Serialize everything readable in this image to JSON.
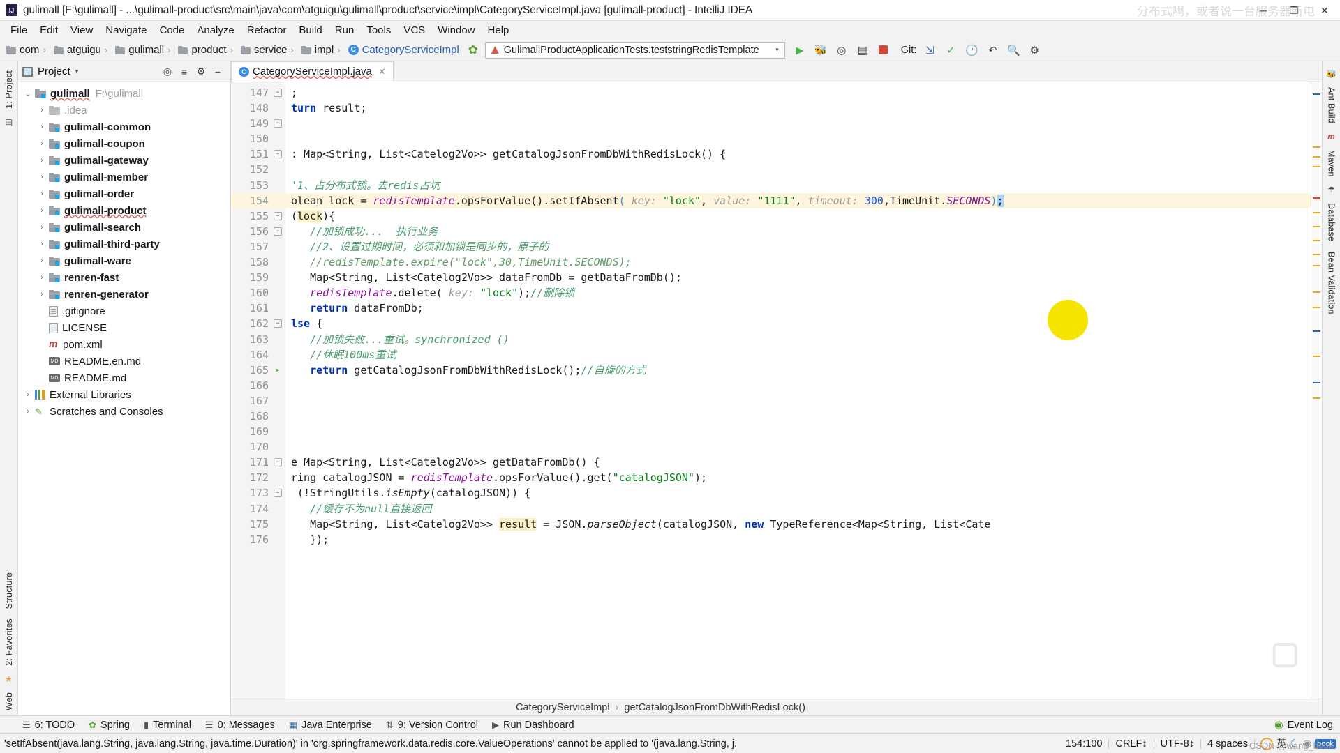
{
  "window": {
    "title": "gulimall [F:\\gulimall] - ...\\gulimall-product\\src\\main\\java\\com\\atguigu\\gulimall\\product\\service\\impl\\CategoryServiceImpl.java [gulimall-product] - IntelliJ IDEA",
    "logo_text": "IJ",
    "minimize": "─",
    "maximize": "❐",
    "close": "✕",
    "watermark": "分布式啊，或者说一台服务器断电"
  },
  "menubar": {
    "items": [
      "File",
      "Edit",
      "View",
      "Navigate",
      "Code",
      "Analyze",
      "Refactor",
      "Build",
      "Run",
      "Tools",
      "VCS",
      "Window",
      "Help"
    ]
  },
  "breadcrumb": {
    "items": [
      {
        "label": "com",
        "icon": "folder-icon"
      },
      {
        "label": "atguigu",
        "icon": "folder-icon"
      },
      {
        "label": "gulimall",
        "icon": "folder-icon"
      },
      {
        "label": "product",
        "icon": "folder-icon"
      },
      {
        "label": "service",
        "icon": "folder-icon"
      },
      {
        "label": "impl",
        "icon": "folder-icon"
      },
      {
        "label": "CategoryServiceImpl",
        "icon": "class-icon"
      }
    ],
    "separator": "›"
  },
  "toolbar": {
    "spring_icon": "spring-leaf-icon",
    "run_config": "GulimallProductApplicationTests.teststringRedisTemplate",
    "run_config_caret": "▾",
    "run_button": "▶",
    "debug_button": "debug-icon",
    "run_coverage_button": "coverage-icon",
    "profile_button": "profiler-icon",
    "stop_button": "stop-icon",
    "git_label": "Git:",
    "git_update": "update-icon",
    "git_commit": "✓",
    "git_history": "history-icon",
    "git_rollback": "↶",
    "search_button": "search-everywhere-icon",
    "settings_button": "gear-icon"
  },
  "left_rail": {
    "items": [
      "1: Project",
      "2: Favorites",
      "Structure",
      "Web"
    ]
  },
  "right_rail": {
    "items": [
      "Ant Build",
      "Maven",
      "Database",
      "Bean Validation"
    ]
  },
  "project_panel": {
    "title": "Project",
    "caret": "▾",
    "actions": [
      "locate-icon",
      "collapse-all-icon",
      "gear-icon",
      "hide-icon"
    ],
    "tree": [
      {
        "indent": 0,
        "arrow": "⌄",
        "icon": "folder-module-icon",
        "label": "gulimall",
        "bold": true,
        "path": "F:\\gulimall"
      },
      {
        "indent": 1,
        "arrow": "›",
        "icon": "folder-plain-icon",
        "label": ".idea",
        "dim": true
      },
      {
        "indent": 1,
        "arrow": "›",
        "icon": "folder-module-icon",
        "label": "gulimall-common",
        "bold": true
      },
      {
        "indent": 1,
        "arrow": "›",
        "icon": "folder-module-icon",
        "label": "gulimall-coupon",
        "bold": true
      },
      {
        "indent": 1,
        "arrow": "›",
        "icon": "folder-module-icon",
        "label": "gulimall-gateway",
        "bold": true
      },
      {
        "indent": 1,
        "arrow": "›",
        "icon": "folder-module-icon",
        "label": "gulimall-member",
        "bold": true
      },
      {
        "indent": 1,
        "arrow": "›",
        "icon": "folder-module-icon",
        "label": "gulimall-order",
        "bold": true
      },
      {
        "indent": 1,
        "arrow": "›",
        "icon": "folder-module-icon",
        "label": "gulimall-product",
        "bold": true
      },
      {
        "indent": 1,
        "arrow": "›",
        "icon": "folder-module-icon",
        "label": "gulimall-search",
        "bold": true
      },
      {
        "indent": 1,
        "arrow": "›",
        "icon": "folder-module-icon",
        "label": "gulimall-third-party",
        "bold": true
      },
      {
        "indent": 1,
        "arrow": "›",
        "icon": "folder-module-icon",
        "label": "gulimall-ware",
        "bold": true
      },
      {
        "indent": 1,
        "arrow": "›",
        "icon": "folder-module-icon",
        "label": "renren-fast",
        "bold": true
      },
      {
        "indent": 1,
        "arrow": "›",
        "icon": "folder-module-icon",
        "label": "renren-generator",
        "bold": true
      },
      {
        "indent": 1,
        "arrow": "",
        "icon": "file-icon",
        "label": ".gitignore"
      },
      {
        "indent": 1,
        "arrow": "",
        "icon": "file-icon",
        "label": "LICENSE"
      },
      {
        "indent": 1,
        "arrow": "",
        "icon": "maven-icon",
        "label": "pom.xml"
      },
      {
        "indent": 1,
        "arrow": "",
        "icon": "markdown-icon",
        "label": "README.en.md"
      },
      {
        "indent": 1,
        "arrow": "",
        "icon": "markdown-icon",
        "label": "README.md"
      },
      {
        "indent": 0,
        "arrow": "›",
        "icon": "library-icon",
        "label": "External Libraries"
      },
      {
        "indent": 0,
        "arrow": "›",
        "icon": "scratch-icon",
        "label": "Scratches and Consoles"
      }
    ]
  },
  "editor": {
    "tab": {
      "label": "CategoryServiceImpl.java",
      "icon": "class-icon",
      "close": "✕"
    },
    "first_line_number": 147,
    "highlighted_line": 154,
    "lines": [
      {
        "n": 147,
        "fold": "−"
      },
      {
        "n": 148
      },
      {
        "n": 149,
        "fold": "−"
      },
      {
        "n": 150
      },
      {
        "n": 151,
        "fold": "−"
      },
      {
        "n": 152
      },
      {
        "n": 153
      },
      {
        "n": 154
      },
      {
        "n": 155,
        "fold": "−"
      },
      {
        "n": 156,
        "fold": "−"
      },
      {
        "n": 157
      },
      {
        "n": 158
      },
      {
        "n": 159
      },
      {
        "n": 160
      },
      {
        "n": 161
      },
      {
        "n": 162,
        "fold": "−"
      },
      {
        "n": 163
      },
      {
        "n": 164
      },
      {
        "n": 165,
        "fold": "run"
      },
      {
        "n": 166
      },
      {
        "n": 167
      },
      {
        "n": 168
      },
      {
        "n": 169
      },
      {
        "n": 170
      },
      {
        "n": 171,
        "fold": "−"
      },
      {
        "n": 172
      },
      {
        "n": 173,
        "fold": "−"
      },
      {
        "n": 174
      },
      {
        "n": 175
      },
      {
        "n": 176
      }
    ],
    "bottom_breadcrumb": [
      "CategoryServiceImpl",
      "getCatalogJsonFromDbWithRedisLock()"
    ],
    "bottom_breadcrumb_sep": "›"
  },
  "tool_windows": {
    "items": [
      {
        "label": "6: TODO",
        "icon": "todo-icon"
      },
      {
        "label": "Spring",
        "icon": "spring-icon"
      },
      {
        "label": "Terminal",
        "icon": "terminal-icon"
      },
      {
        "label": "0: Messages",
        "icon": "messages-icon"
      },
      {
        "label": "Java Enterprise",
        "icon": "java-ee-icon"
      },
      {
        "label": "9: Version Control",
        "icon": "vcs-icon"
      },
      {
        "label": "Run Dashboard",
        "icon": "run-dashboard-icon"
      }
    ],
    "event_log": "Event Log",
    "event_log_icon": "event-log-icon"
  },
  "status_bar": {
    "message": "'setIfAbsent(java.lang.String, java.lang.String, java.time.Duration)' in 'org.springframework.data.redis.core.ValueOperations' cannot be applied to '(java.lang.String, j.",
    "caret": "154:100",
    "line_separator": "CRLF",
    "line_separator_caret": "↕",
    "encoding": "UTF-8",
    "encoding_caret": "↕",
    "indent": "4 spaces",
    "ime_lang": "英",
    "ime_badge": "book",
    "csdn": "CSDN @wang_book"
  },
  "colors": {
    "accent_blue": "#2a62b5",
    "keyword": "#0033b3",
    "string": "#067d17",
    "number": "#1750eb",
    "comment": "#8c8c8c",
    "chinese_comment": "#4a9c6d",
    "field": "#871094",
    "highlight_line": "#fdf6dd",
    "selection": "#a6d2ff",
    "error_red": "#e06c5e",
    "run_green": "#5aa02c"
  }
}
